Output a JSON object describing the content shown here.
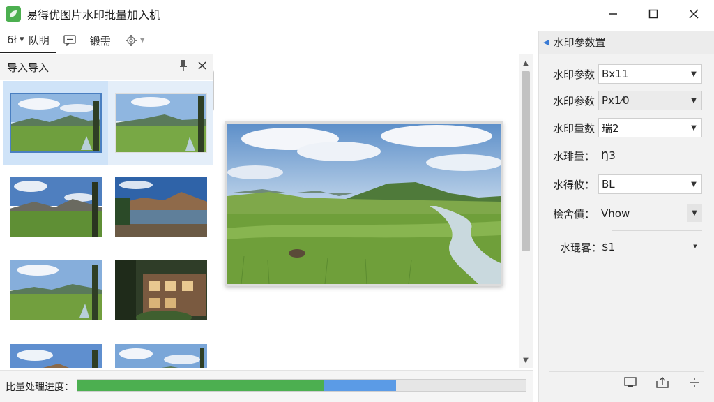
{
  "window": {
    "title": "易得优图片水印批量加入机",
    "minimize": "—",
    "maximize": "☐",
    "close": "✕"
  },
  "toolbar": {
    "items": [
      {
        "label": "6ł",
        "icon": "import-icon"
      },
      {
        "label": "队眀",
        "icon": ""
      },
      {
        "label": "",
        "icon": "comment-icon"
      },
      {
        "label": "锻需",
        "icon": ""
      },
      {
        "label": "",
        "icon": "gear-icon"
      }
    ]
  },
  "left_panel": {
    "title": "导入导入"
  },
  "right_panel": {
    "title": "水印参数置",
    "fields": [
      {
        "label": "水印参数",
        "value": "Bx11",
        "dropdown": true
      },
      {
        "label": "水印参数",
        "value": "Px1⁄0",
        "dropdown": true
      },
      {
        "label": "水印量数",
        "value": "瑞2",
        "dropdown": true
      },
      {
        "label": "水琲量：",
        "value": "Ŋ3",
        "dropdown": false
      },
      {
        "label": "水得攸：",
        "value": "BL",
        "dropdown": true
      },
      {
        "label": "桧舍僨：",
        "value": "Vhow",
        "dropdown": true
      },
      {
        "label": "水琨畧：",
        "value": "$1",
        "dropdown": true
      }
    ]
  },
  "status": {
    "progress_label": "比量处理进度：",
    "progress_green_fraction": 0.55,
    "progress_blue_fraction": 0.16
  },
  "colors": {
    "accent_blue": "#5b9be6",
    "progress_green": "#4caf50",
    "selection": "#cfe3f8"
  }
}
